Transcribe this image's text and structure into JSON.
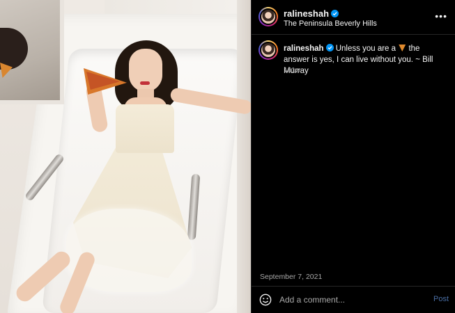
{
  "post": {
    "image_alt": "Woman in white dress lying in a bathtub holding a slice of pizza"
  },
  "header": {
    "username": "ralineshah",
    "location": "The Peninsula Beverly Hills",
    "more_icon": "more-options-icon"
  },
  "caption": {
    "username": "ralineshah",
    "text_before": "Unless you are a",
    "emoji": "pizza-emoji",
    "text_after": "the answer is yes, I can live without you. ~ Bill Murray",
    "age": "161w"
  },
  "footer": {
    "date": "September 7, 2021",
    "comment_placeholder": "Add a comment...",
    "post_label": "Post"
  },
  "colors": {
    "background": "#000000",
    "verified": "#0095f6",
    "post_button": "#4a6fa5",
    "muted_text": "#a8a8a8"
  }
}
